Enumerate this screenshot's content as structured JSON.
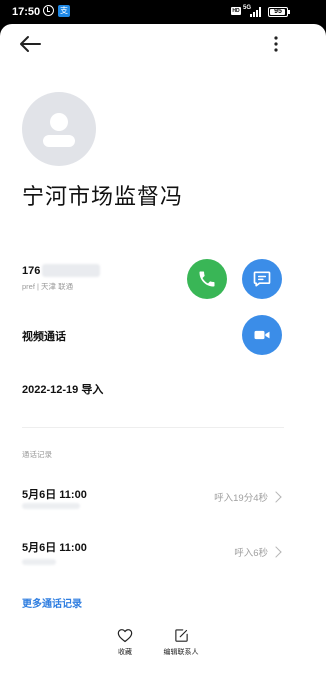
{
  "status_bar": {
    "time": "17:50",
    "app_icon": "支",
    "hd_label": "HD",
    "network": "5G",
    "battery": 95,
    "battery_label": "95"
  },
  "header": {
    "back_icon": "arrow-left-icon",
    "more_icon": "more-vertical-icon"
  },
  "contact": {
    "name": "宁河市场监督冯",
    "phone_prefix": "176",
    "phone_sub": "pref | 天津 联通",
    "video_call_label": "视频通话",
    "import_label": "2022-12-19 导入"
  },
  "actions": {
    "call_icon": "phone-icon",
    "message_icon": "message-icon",
    "video_icon": "video-icon"
  },
  "call_log": {
    "title": "通话记录",
    "entries": [
      {
        "date": "5月6日 11:00",
        "info": "呼入19分4秒"
      },
      {
        "date": "5月6日 11:00",
        "info": "呼入6秒"
      }
    ],
    "more_label": "更多通话记录"
  },
  "bottom_bar": {
    "favorite_label": "收藏",
    "edit_label": "编辑联系人"
  },
  "colors": {
    "call_green": "#39b656",
    "action_blue": "#3b8de8",
    "link_blue": "#2f7ee0"
  }
}
